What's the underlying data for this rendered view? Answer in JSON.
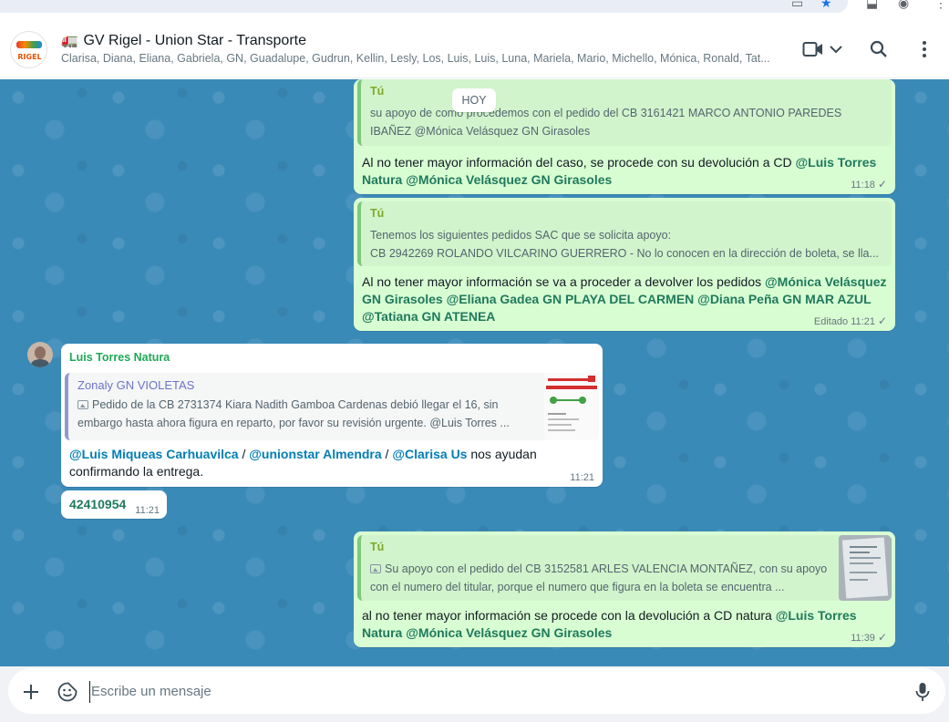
{
  "header": {
    "avatar_text": "RIGEL",
    "title": "GV Rigel - Union Star - Transporte",
    "members": "Clarisa, Diana, Eliana, Gabriela, GN, Guadalupe, Gudrun, Kellin, Lesly, Los, Luis, Luis, Luna, Mariela, Mario, Michello, Mónica, Ronald, Tat...",
    "icons": [
      "video-call-icon",
      "chevron-down-icon",
      "search-icon",
      "more-options-icon"
    ]
  },
  "day_chip": "HOY",
  "messages": [
    {
      "quote_author": "Tú",
      "quote_text": "su apoyo de como procedemos con el pedido del CB 3161421 MARCO ANTONIO PAREDES IBAÑEZ @Mónica Velásquez GN Girasoles",
      "text_plain": "Al no tener mayor información del caso, se procede con su devolución a CD ",
      "mention_1": "@Luis Torres Natura",
      "mention_2": "@Mónica Velásquez GN Girasoles",
      "time": "11:18"
    },
    {
      "quote_author": "Tú",
      "quote_line_1": "Tenemos los siguientes pedidos SAC que se solicita apoyo:",
      "quote_line_2": "CB 2942269 ROLANDO VILCARINO GUERRERO - No lo conocen en la dirección de boleta, se lla...",
      "text_plain": "Al no tener mayor información se va a proceder a devolver los pedidos ",
      "mention_1": "@Mónica Velásquez GN Girasoles",
      "mention_2": "@Eliana Gadea GN PLAYA DEL CARMEN",
      "mention_3": "@Diana Peña GN MAR AZUL",
      "mention_4": "@Tatiana GN ATENEA",
      "time": "Editado 11:21"
    },
    {
      "sender": "Luis Torres Natura",
      "quote_author": "Zonaly GN VIOLETAS",
      "quote_line_1": "Pedido de la CB 2731374 Kiara Nadith Gamboa Cardenas debió llegar el 16, sin",
      "quote_line_2": "embargo hasta ahora figura en reparto, por favor su revisión urgente. @Luis Torres ...",
      "mention_1": "@Luis Miqueas Carhuavilca",
      "sep": " / ",
      "mention_2": "@unionstar Almendra",
      "mention_3": "@Clarisa Us",
      "text_after": " nos ayudan",
      "text_line_2": "confirmando la entrega.",
      "time": "11:21"
    },
    {
      "text": "42410954",
      "time": "11:21"
    },
    {
      "quote_author": "Tú",
      "quote_line_1": "Su apoyo con el pedido del CB 3152581 ARLES VALENCIA MONTAÑEZ, con su apoyo",
      "quote_line_2": "con el numero del titular, porque el numero que figura en la boleta se encuentra ...",
      "text_plain": "al no tener mayor información se procede con la devolución a CD natura ",
      "mention_1": "@Luis Torres Natura",
      "mention_2": "@Mónica Velásquez GN Girasoles",
      "time": "11:39"
    }
  ],
  "composer": {
    "placeholder": "Escribe un mensaje",
    "icons": [
      "plus-icon",
      "sticker-icon",
      "microphone-icon"
    ]
  },
  "colors": {
    "outgoing_bubble": "#d9fdd3",
    "incoming_bubble": "#ffffff",
    "chat_background": "#3a8ab8",
    "mention_color": "#1f7a5c"
  }
}
